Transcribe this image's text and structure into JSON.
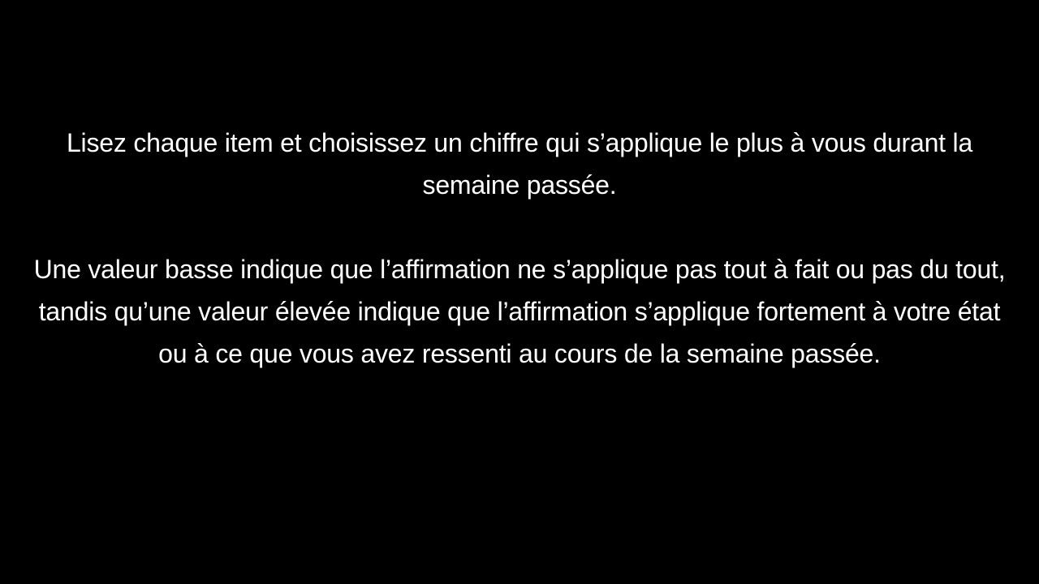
{
  "slide": {
    "background_color": "#000000",
    "text_color": "#ffffff",
    "paragraph_1": "Lisez chaque item et choisissez un chiffre qui s’applique le plus à vous durant la semaine passée.",
    "paragraph_2": "Une valeur basse indique que l’affirmation ne s’applique pas tout à fait ou pas du tout, tandis qu’une valeur élevée indique que l’affirmation s’applique fortement à votre état ou à ce que vous avez ressenti au cours de la semaine passée."
  }
}
